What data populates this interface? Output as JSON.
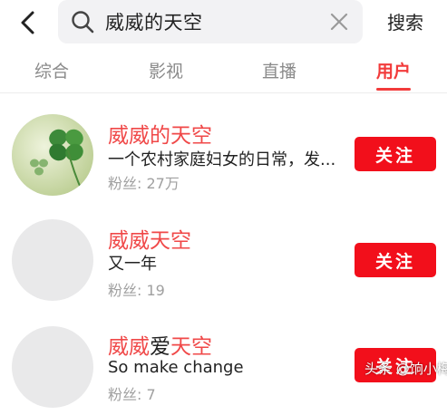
{
  "header": {
    "back_icon": "chevron-left-icon",
    "search_query": "威威的天空",
    "search_icon": "search-icon",
    "clear_icon": "close-icon",
    "search_button_label": "搜索"
  },
  "tabs": [
    {
      "label": "综合",
      "active": false
    },
    {
      "label": "影视",
      "active": false
    },
    {
      "label": "直播",
      "active": false
    },
    {
      "label": "用户",
      "active": true
    }
  ],
  "users": [
    {
      "name": "威威的天空",
      "bio": "一个农村家庭妇女的日常，发...",
      "fans": "粉丝: 27万",
      "follow_label": "关注",
      "avatar": "clover-avatar"
    },
    {
      "name": "威威天空",
      "bio": "又一年",
      "fans": "粉丝: 19",
      "follow_label": "关注",
      "avatar": "blank-avatar"
    },
    {
      "name_parts": [
        "威威",
        "爱",
        "天空"
      ],
      "bio": "So make change",
      "fans": "粉丝: 7",
      "follow_label": "关注",
      "avatar": "blank-avatar"
    }
  ],
  "watermark": "头条 @饷小梅",
  "colors": {
    "accent": "#f23b3b",
    "follow_button": "#f20f1b",
    "search_bg": "#f2f2f4"
  }
}
